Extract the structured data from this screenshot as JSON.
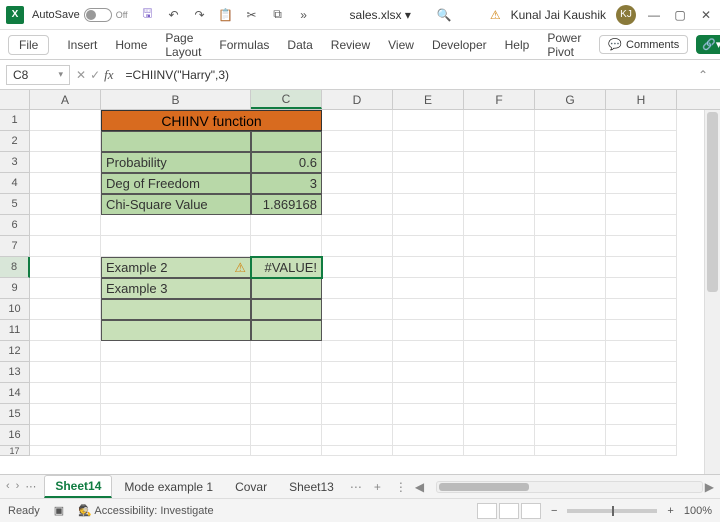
{
  "titlebar": {
    "autosave_label": "AutoSave",
    "autosave_state": "Off",
    "filename": "sales.xlsx ▾",
    "user_name": "Kunal Jai Kaushik",
    "user_initials": "KJ"
  },
  "ribbon": {
    "tabs": [
      "File",
      "Insert",
      "Home",
      "Page Layout",
      "Formulas",
      "Data",
      "Review",
      "View",
      "Developer",
      "Help",
      "Power Pivot"
    ],
    "comments_label": "Comments"
  },
  "formula_bar": {
    "name_box": "C8",
    "formula": "=CHIINV(\"Harry\",3)"
  },
  "columns": [
    "A",
    "B",
    "C",
    "D",
    "E",
    "F",
    "G",
    "H"
  ],
  "rows_count": 17,
  "cells": {
    "header_title": "CHIINV function",
    "b3": "Probability",
    "c3": "0.6",
    "b4": "Deg of Freedom",
    "c4": "3",
    "b5": "Chi-Square Value",
    "c5": "1.869168",
    "b8": "Example 2",
    "c8": "#VALUE!",
    "b9": "Example 3"
  },
  "sheet_tabs": {
    "active": "Sheet14",
    "others": [
      "Mode example 1",
      "Covar",
      "Sheet13"
    ]
  },
  "status": {
    "ready": "Ready",
    "accessibility": "Accessibility: Investigate",
    "zoom": "100%"
  }
}
